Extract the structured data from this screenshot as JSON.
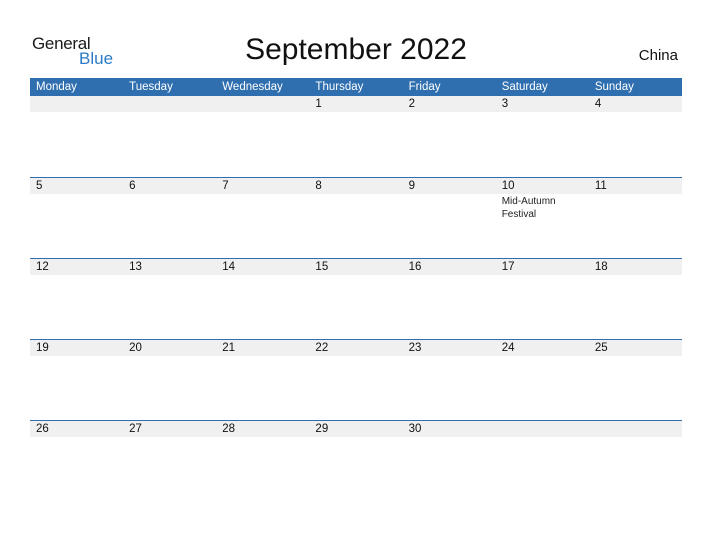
{
  "logo": {
    "general": "General",
    "blue": "Blue"
  },
  "title": "September 2022",
  "country": "China",
  "colors": {
    "accent": "#2f6fb0",
    "logo_blue": "#2a7bc4",
    "date_row_bg": "#f0f0f0"
  },
  "weekdays": [
    "Monday",
    "Tuesday",
    "Wednesday",
    "Thursday",
    "Friday",
    "Saturday",
    "Sunday"
  ],
  "weeks": [
    {
      "days": [
        "",
        "",
        "",
        "1",
        "2",
        "3",
        "4"
      ],
      "events": [
        "",
        "",
        "",
        "",
        "",
        "",
        ""
      ]
    },
    {
      "days": [
        "5",
        "6",
        "7",
        "8",
        "9",
        "10",
        "11"
      ],
      "events": [
        "",
        "",
        "",
        "",
        "",
        "Mid-Autumn Festival",
        ""
      ]
    },
    {
      "days": [
        "12",
        "13",
        "14",
        "15",
        "16",
        "17",
        "18"
      ],
      "events": [
        "",
        "",
        "",
        "",
        "",
        "",
        ""
      ]
    },
    {
      "days": [
        "19",
        "20",
        "21",
        "22",
        "23",
        "24",
        "25"
      ],
      "events": [
        "",
        "",
        "",
        "",
        "",
        "",
        ""
      ]
    },
    {
      "days": [
        "26",
        "27",
        "28",
        "29",
        "30",
        "",
        ""
      ],
      "events": [
        "",
        "",
        "",
        "",
        "",
        "",
        ""
      ]
    }
  ]
}
